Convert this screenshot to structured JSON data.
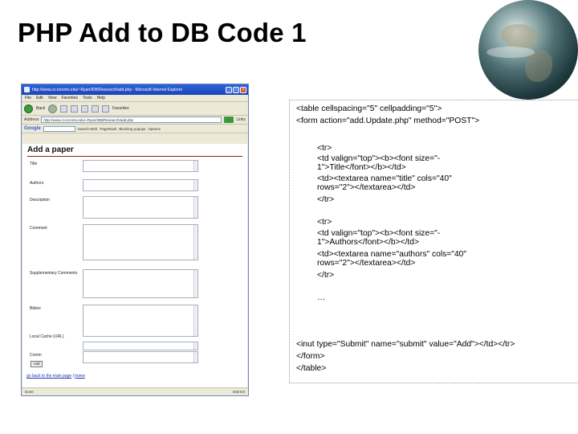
{
  "slide": {
    "title": "PHP Add to DB Code 1"
  },
  "browser": {
    "window_title": "http://www.cs.toronto.edu/~Ryan/IDB/Research/add.php - Microsoft Internet Explorer",
    "menu": [
      "File",
      "Edit",
      "View",
      "Favorites",
      "Tools",
      "Help"
    ],
    "toolbar": {
      "back_label": "Back",
      "favorites_label": "Favorites"
    },
    "address": {
      "label": "Address",
      "value": "http://www.cs.toronto.edu/~Ryan/IDB/Research/add.php",
      "go_label": "Go",
      "links_label": "Links"
    },
    "google": {
      "logo": "Google",
      "items": [
        "Search Web",
        "PageRank",
        "Blocking popups",
        "Options"
      ]
    },
    "page": {
      "heading": "Add a paper",
      "fields": [
        "Title",
        "Authors",
        "Description",
        "Comment",
        "Supplementary Comments",
        "Bibtex",
        "Local Cache (URL)",
        "Comm"
      ],
      "submit_label": "Add",
      "back_link": "go back to the main page",
      "separator": " | ",
      "home_link": "home"
    },
    "status": {
      "left": "Done",
      "right": "Internet"
    }
  },
  "code": {
    "line1": "<table cellspacing=\"5\" cellpadding=\"5\">",
    "line2": "<form action=\"add.Update.php\" method=\"POST\">",
    "line3": "<tr>",
    "line4": "<td valign=\"top\"><b><font size=\"-",
    "line5": "1\">Title</font></b></td>",
    "line6": "<td><textarea name=\"title\" cols=\"40\"",
    "line7": "rows=\"2\"></textarea></td>",
    "line8": "</tr>",
    "line9": "<tr>",
    "line10": "<td valign=\"top\"><b><font size=\"-",
    "line11": "1\">Authors</font></b></td>",
    "line12": "<td><textarea name=\"authors\" cols=\"40\"",
    "line13": "rows=\"2\"></textarea></td>",
    "line14": "</tr>",
    "line15": "…",
    "line16": "<inut type=\"Submit\" name=\"submit\" value=\"Add\"></td></tr>",
    "line17": "</form>",
    "line18": "</table>"
  }
}
